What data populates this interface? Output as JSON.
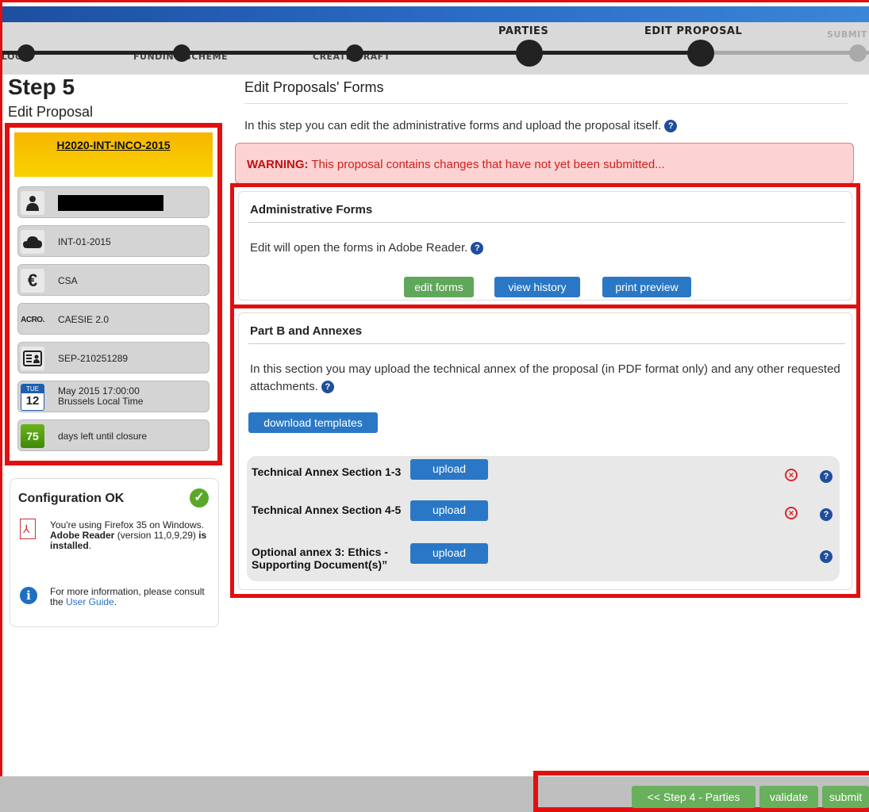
{
  "progress": {
    "steps": [
      {
        "label": "LOGIN"
      },
      {
        "label": "FUNDING SCHEME"
      },
      {
        "label": "CREATE DRAFT"
      },
      {
        "label": "PARTIES"
      },
      {
        "label": "EDIT PROPOSAL"
      },
      {
        "label": "SUBMIT"
      }
    ]
  },
  "sidebar": {
    "step_title": "Step 5",
    "step_subtitle": "Edit Proposal",
    "call_id": "H2020-INT-INCO-2015",
    "items": [
      {
        "icon": "person-icon",
        "value": ""
      },
      {
        "icon": "cloud-icon",
        "value": "INT-01-2015"
      },
      {
        "icon": "euro-icon",
        "value": "CSA"
      },
      {
        "icon": "acronym-icon",
        "icon_text": "ACRO.",
        "value": "CAESIE 2.0"
      },
      {
        "icon": "id-card-icon",
        "value": "SEP-210251289"
      },
      {
        "icon": "calendar-icon",
        "cal_month": "TUE",
        "cal_day": "12",
        "value_line1": "May 2015  17:00:00",
        "value_line2": "Brussels Local Time"
      },
      {
        "icon": "days-left-icon",
        "days": "75",
        "value": "days left until closure"
      }
    ],
    "config": {
      "title": "Configuration OK",
      "text_1": "You're using Firefox 35 on Windows. ",
      "text_bold_1": "Adobe Reader",
      "text_2": " (version 11,0,9,29) ",
      "text_bold_2": "is installed",
      "text_3": ".",
      "info_text": "For more information, please consult the ",
      "info_link": "User Guide",
      "info_end": "."
    }
  },
  "main": {
    "title": "Edit Proposals' Forms",
    "intro": "In this step you can edit the administrative forms and upload the proposal itself.",
    "warning_label": "WARNING:",
    "warning_text": " This proposal contains changes that have not yet been submitted...",
    "admin": {
      "title": "Administrative Forms",
      "text": "Edit will open the forms in Adobe Reader.",
      "buttons": {
        "edit": "edit forms",
        "history": "view history",
        "preview": "print preview"
      }
    },
    "partb": {
      "title": "Part B and Annexes",
      "text": "In this section you may upload the technical annex of the proposal (in PDF format only) and any other requested attachments.",
      "download": "download templates",
      "uploads": [
        {
          "label": "Technical Annex Section 1-3",
          "button": "upload",
          "removable": true
        },
        {
          "label": "Technical Annex Section 4-5",
          "button": "upload",
          "removable": true
        },
        {
          "label": "Optional annex 3: Ethics - Supporting Document(s)”",
          "button": "upload",
          "removable": false
        }
      ]
    }
  },
  "footer": {
    "back": "<< Step 4 - Parties",
    "validate": "validate",
    "submit": "submit"
  }
}
